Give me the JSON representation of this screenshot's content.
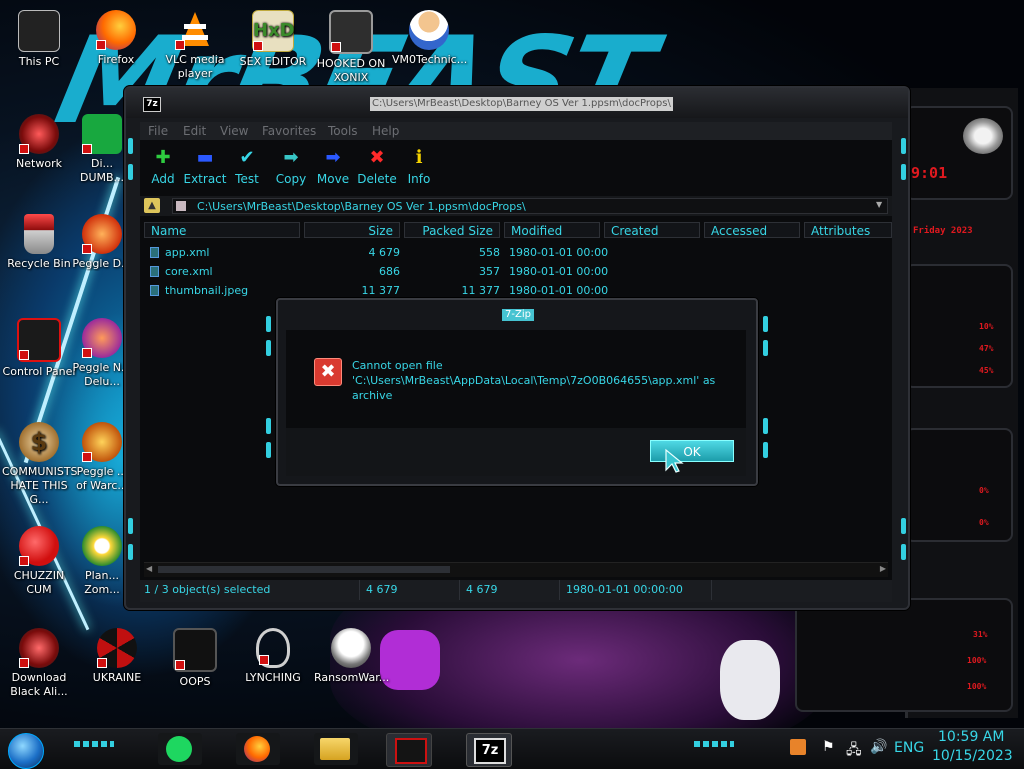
{
  "desktop": {
    "icons": [
      {
        "label": "This PC"
      },
      {
        "label": "Firefox"
      },
      {
        "label": "VLC media player"
      },
      {
        "label": "SEX EDITOR"
      },
      {
        "label": "HOOKED ON XONIX"
      },
      {
        "label": "VM0Technic..."
      },
      {
        "label": "Network"
      },
      {
        "label": "Di... DUMB..."
      },
      {
        "label": "Recycle Bin"
      },
      {
        "label": "Peggle D..."
      },
      {
        "label": "Control Panel"
      },
      {
        "label": "Peggle N... Delu..."
      },
      {
        "label": "COMMUNISTS HATE THIS G..."
      },
      {
        "label": "Peggle ... of Warc..."
      },
      {
        "label": "CHUZZIN CUM"
      },
      {
        "label": "Plan... Zom..."
      },
      {
        "label": "Download Black Ali..."
      },
      {
        "label": "UKRAINE"
      },
      {
        "label": "OOPS"
      },
      {
        "label": "LYNCHING"
      },
      {
        "label": "RansomWar..."
      }
    ]
  },
  "window": {
    "title": "C:\\Users\\MrBeast\\Desktop\\Barney OS Ver 1.ppsm\\docProps\\",
    "icon_label": "7z",
    "menu": [
      "File",
      "Edit",
      "View",
      "Favorites",
      "Tools",
      "Help"
    ],
    "toolbar": [
      {
        "label": "Add",
        "icon": "plus-icon",
        "color": "#2ecc40"
      },
      {
        "label": "Extract",
        "icon": "minus-icon",
        "color": "#2b59ff"
      },
      {
        "label": "Test",
        "icon": "check-icon",
        "color": "#38d6e6"
      },
      {
        "label": "Copy",
        "icon": "arrow-right-icon",
        "color": "#38c6c6"
      },
      {
        "label": "Move",
        "icon": "arrow-right-icon",
        "color": "#2b59ff"
      },
      {
        "label": "Delete",
        "icon": "x-icon",
        "color": "#ff2a2a"
      },
      {
        "label": "Info",
        "icon": "info-icon",
        "color": "#f5d300"
      }
    ],
    "address": "C:\\Users\\MrBeast\\Desktop\\Barney OS Ver 1.ppsm\\docProps\\",
    "columns": [
      "Name",
      "Size",
      "Packed Size",
      "Modified",
      "Created",
      "Accessed",
      "Attributes"
    ],
    "files": [
      {
        "name": "app.xml",
        "size": "4 679",
        "packed": "558",
        "modified": "1980-01-01 00:00"
      },
      {
        "name": "core.xml",
        "size": "686",
        "packed": "357",
        "modified": "1980-01-01 00:00"
      },
      {
        "name": "thumbnail.jpeg",
        "size": "11 377",
        "packed": "11 377",
        "modified": "1980-01-01 00:00"
      }
    ],
    "status": {
      "selected": "1 / 3 object(s) selected",
      "size": "4 679",
      "packed": "4 679",
      "modified": "1980-01-01 00:00:00"
    }
  },
  "dialog": {
    "title": "7-Zip",
    "message": "Cannot open file\n'C:\\Users\\MrBeast\\AppData\\Local\\Temp\\7zO0B064655\\app.xml' as\narchive",
    "ok_label": "OK"
  },
  "taskbar": {
    "language": "ENG",
    "time": "10:59 AM",
    "date": "10/15/2023",
    "apps": [
      "spotify-icon",
      "firefox-icon",
      "file-explorer-icon",
      "alien-widget-icon",
      "7zip-icon"
    ]
  },
  "widget": {
    "time_partial": "9:01",
    "lines": [
      "Friday 2023",
      "10%",
      "47%",
      "45%",
      "0%",
      "0%",
      "31%",
      "100%",
      "100%"
    ]
  }
}
